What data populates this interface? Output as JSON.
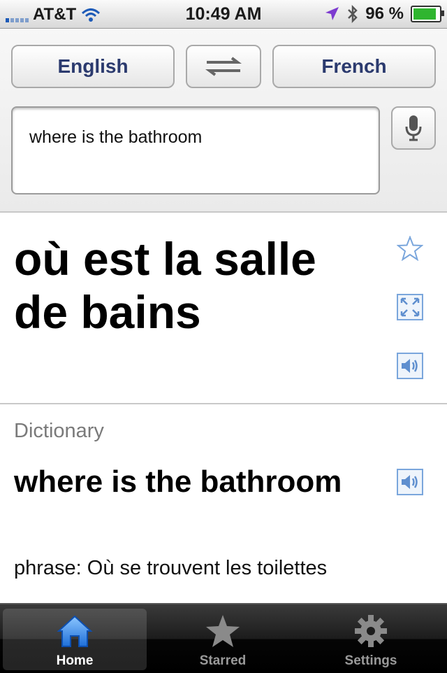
{
  "status_bar": {
    "carrier": "AT&T",
    "time": "10:49 AM",
    "battery": "96 %"
  },
  "toolbar": {
    "source_language": "English",
    "target_language": "French"
  },
  "input": {
    "value": "where is the bathroom"
  },
  "translation": {
    "text": "où est la salle de bains"
  },
  "dictionary": {
    "heading": "Dictionary",
    "term": "where is the bathroom",
    "definition": "phrase: Où se trouvent les toilettes"
  },
  "tabs": [
    {
      "label": "Home",
      "icon": "home-icon",
      "active": true
    },
    {
      "label": "Starred",
      "icon": "star-icon",
      "active": false
    },
    {
      "label": "Settings",
      "icon": "gear-icon",
      "active": false
    }
  ],
  "colors": {
    "accent_blue": "#3d8ee6",
    "button_text": "#2b3a6e",
    "icon_blue": "#6f9fd8"
  }
}
